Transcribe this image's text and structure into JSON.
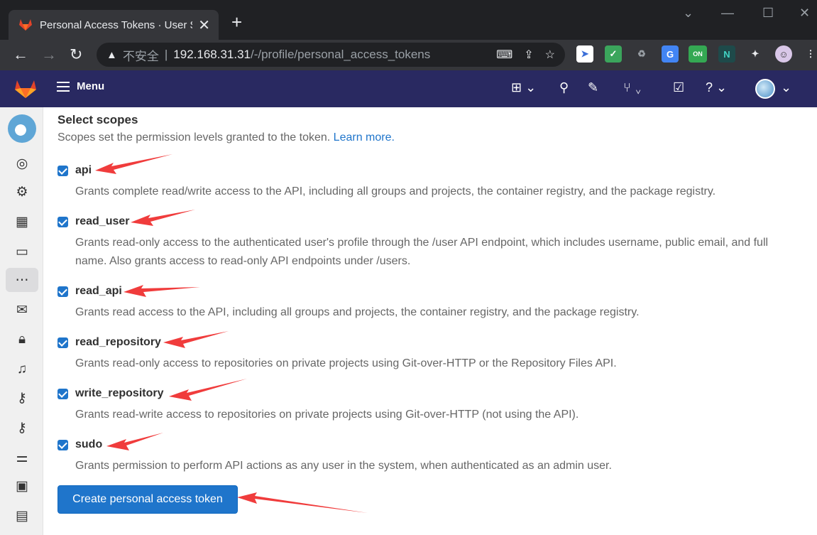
{
  "browser": {
    "tab_title": "Personal Access Tokens · User S",
    "new_tab": "+",
    "close": "✕",
    "insecure_label": "不安全",
    "url_host": "192.168.31.31",
    "url_path": "/-/profile/personal_access_tokens",
    "ext_on_badge": "ON"
  },
  "gitlab": {
    "menu_label": "Menu"
  },
  "scopes": {
    "heading": "Select scopes",
    "description": "Scopes set the permission levels granted to the token.",
    "learn_more": "Learn more.",
    "items": [
      {
        "name": "api",
        "help": "Grants complete read/write access to the API, including all groups and projects, the container registry, and the package registry.",
        "checked": true
      },
      {
        "name": "read_user",
        "help": "Grants read-only access to the authenticated user's profile through the /user API endpoint, which includes username, public email, and full name. Also grants access to read-only API endpoints under /users.",
        "checked": true
      },
      {
        "name": "read_api",
        "help": "Grants read access to the API, including all groups and projects, the container registry, and the package registry.",
        "checked": true
      },
      {
        "name": "read_repository",
        "help": "Grants read-only access to repositories on private projects using Git-over-HTTP or the Repository Files API.",
        "checked": true
      },
      {
        "name": "write_repository",
        "help": "Grants read-write access to repositories on private projects using Git-over-HTTP (not using the API).",
        "checked": true
      },
      {
        "name": "sudo",
        "help": "Grants permission to perform API actions as any user in the system, when authenticated as an admin user.",
        "checked": true
      }
    ]
  },
  "create_button": "Create personal access token",
  "colors": {
    "header": "#292961",
    "primary": "#1f75cb",
    "annotation_arrow": "#f03c3c"
  }
}
